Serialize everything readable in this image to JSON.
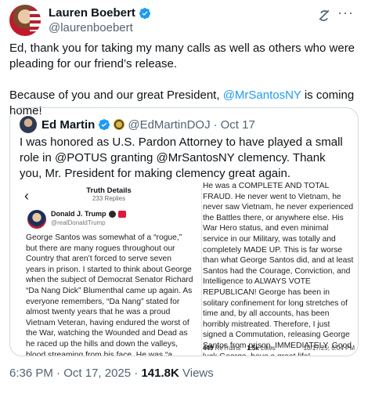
{
  "post": {
    "author_name": "Lauren Boebert",
    "author_handle": "@laurenboebert",
    "text_p1": "Ed, thank you for taking my many calls as well as others who were pleading for our friend’s release.",
    "text_p2_prefix": "Because of you and our great President, ",
    "text_p2_mention": "@MrSantosNY",
    "text_p2_suffix": " is coming home!",
    "time": "6:36 PM",
    "sep1": " · ",
    "date": "Oct 17, 2025",
    "sep2": " · ",
    "views_count": "141.8K",
    "views_label": " Views"
  },
  "quote": {
    "author_name": "Ed Martin",
    "author_handle": "@EdMartinDOJ",
    "dot": "·",
    "date": "Oct 17",
    "text": "I was honored as U.S. Pardon Attorney to have played a small role in @POTUS granting @MrSantosNY clemency. Thank you, Mr. President for making clemency great again."
  },
  "truth_social": {
    "back_glyph": "‹",
    "title": "Truth Details",
    "replies": "233 Replies",
    "author_name": "Donald J. Trump",
    "author_handle": "@realDonaldTrump",
    "left_text": "George Santos was somewhat of a “rogue,” but there are many rogues throughout our Country that aren’t forced to serve seven years in prison. I started to think about George when the subject of Democrat Senator Richard “Da Nang Dick” Blumenthal came up again. As everyone remembers, “Da Nang” stated for almost twenty years that he was a proud Vietnam Veteran, having endured the worst of the War, watching the Wounded and Dead as he raced up the hills and down the valleys, blood streaming from his face. He was “a",
    "right_text": "He was a COMPLETE AND TOTAL FRAUD. He never went to Vietnam, he never saw Vietnam, he never experienced the Battles there, or anywhere else. His War Hero status, and even minimal service in our Military, was totally and completely MADE UP. This is far worse than what George Santos did, and at least Santos had the Courage, Conviction, and Intelligence to ALWAYS VOTE REPUBLICAN! George has been in solitary confinement for long stretches of time and, by all accounts, has been horribly mistreated. Therefore, I just signed a Commutation, releasing George Santos from prison, IMMEDIATELY. Good luck George, have a great life!",
    "retruths_count": "449",
    "retruths_label": " ReTruths",
    "likes_count": "1.5k",
    "likes_label": " Likes",
    "timestamp": "10/17/25, 6:04 PM"
  },
  "colors": {
    "link": "#1d9bf0",
    "muted": "#536471",
    "verified": "#1d9bf0"
  }
}
